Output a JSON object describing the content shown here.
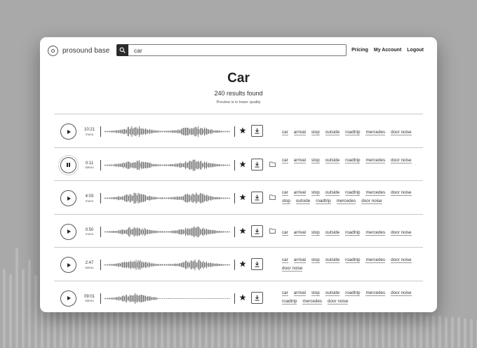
{
  "app": {
    "name": "prosound base"
  },
  "search": {
    "value": "car",
    "placeholder": ""
  },
  "nav": {
    "pricing": "Pricing",
    "account": "My Account",
    "logout": "Logout"
  },
  "page": {
    "title": "Car",
    "results_count": "240 results found",
    "note": "Preview is in lower quality"
  },
  "results": [
    {
      "duration": "10:21",
      "channels": "mono",
      "state": "play",
      "favorite": true,
      "folder": false,
      "more": false,
      "tags": [
        "car",
        "arrival",
        "stop",
        "outside",
        "roadtrip",
        "mercedes",
        "door noise"
      ]
    },
    {
      "duration": "0:11",
      "channels": "stereo",
      "state": "pause",
      "favorite": true,
      "folder": true,
      "more": true,
      "tags": [
        "car",
        "arrival",
        "stop",
        "outside",
        "roadtrip",
        "mercedes",
        "door noise"
      ]
    },
    {
      "duration": "4:03",
      "channels": "mono",
      "state": "play",
      "favorite": true,
      "folder": true,
      "more": false,
      "tags": [
        "car",
        "arrival",
        "stop",
        "outside",
        "roadtrip",
        "mercedes",
        "door noise",
        "stop",
        "outside",
        "roadtrip",
        "mercedes",
        "door noise"
      ]
    },
    {
      "duration": "0:50",
      "channels": "mono",
      "state": "play",
      "favorite": true,
      "folder": true,
      "more": false,
      "tags": [
        "car",
        "arrival",
        "stop",
        "outside",
        "roadtrip",
        "mercedes",
        "door noise"
      ]
    },
    {
      "duration": "2:47",
      "channels": "stereo",
      "state": "play",
      "favorite": true,
      "folder": false,
      "more": false,
      "tags": [
        "car",
        "arrival",
        "stop",
        "outside",
        "roadtrip",
        "mercedes",
        "door noise",
        "door noise"
      ]
    },
    {
      "duration": "09:01",
      "channels": "stereo",
      "state": "play",
      "favorite": true,
      "folder": false,
      "more": false,
      "tags": [
        "car",
        "arrival",
        "stop",
        "outside",
        "roadtrip",
        "mercedes",
        "door noise",
        "roadtrip",
        "mercedes",
        "door noise"
      ]
    }
  ],
  "colors": {
    "background": "#a9a9a9",
    "panel": "#ffffff",
    "text": "#222222",
    "divider": "#c8c8c8",
    "waveform": "#555555"
  },
  "icons": {
    "logo": "circle-logo-icon",
    "search": "search-icon",
    "play": "play-icon",
    "pause": "pause-icon",
    "favorite": "star-icon",
    "download": "download-icon",
    "folder": "folder-icon",
    "more": "more-icon"
  }
}
